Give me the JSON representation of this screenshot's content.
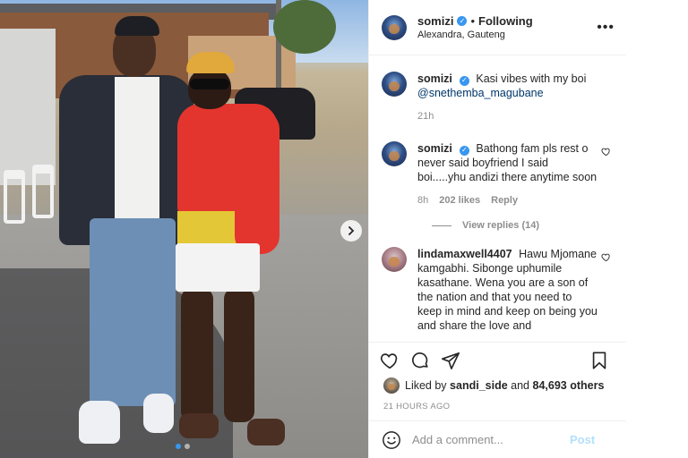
{
  "post": {
    "username": "somizi",
    "verified_glyph": "✓",
    "separator": "•",
    "follow_status": "Following",
    "location": "Alexandra, Gauteng",
    "more_glyph": "•••"
  },
  "comments": [
    {
      "username": "somizi",
      "text": "Kasi vibes with my boi",
      "mention": "@snethemba_magubane",
      "time": "21h"
    },
    {
      "username": "somizi",
      "text": "Bathong fam pls rest o never said boyfriend I said boi.....yhu andizi there anytime soon",
      "time": "8h",
      "likes": "202 likes",
      "reply_label": "Reply",
      "view_replies": "View replies (14)"
    },
    {
      "username": "lindamaxwell4407",
      "text": "Hawu Mjomane kamgabhi. Sibonge uphumile kasathane. Wena you are a son of the nation and that you need to keep in mind and keep on being you and share the love and"
    }
  ],
  "likes": {
    "prefix": "Liked by",
    "user": "sandi_side",
    "middle": "and",
    "count": "84,693 others"
  },
  "timestamp": "21 HOURS AGO",
  "add_comment": {
    "placeholder": "Add a comment...",
    "post_label": "Post"
  },
  "carousel": {
    "total": 2,
    "active": 0
  },
  "colors": {
    "verified": "#3897f0",
    "link": "#00376b",
    "post_disabled": "#b2dffc",
    "meta": "#8e8e8e"
  },
  "icons": [
    "more-options-icon",
    "verified-icon",
    "heart-icon",
    "comment-icon",
    "share-icon",
    "bookmark-icon",
    "emoji-icon",
    "chevron-right-icon"
  ]
}
